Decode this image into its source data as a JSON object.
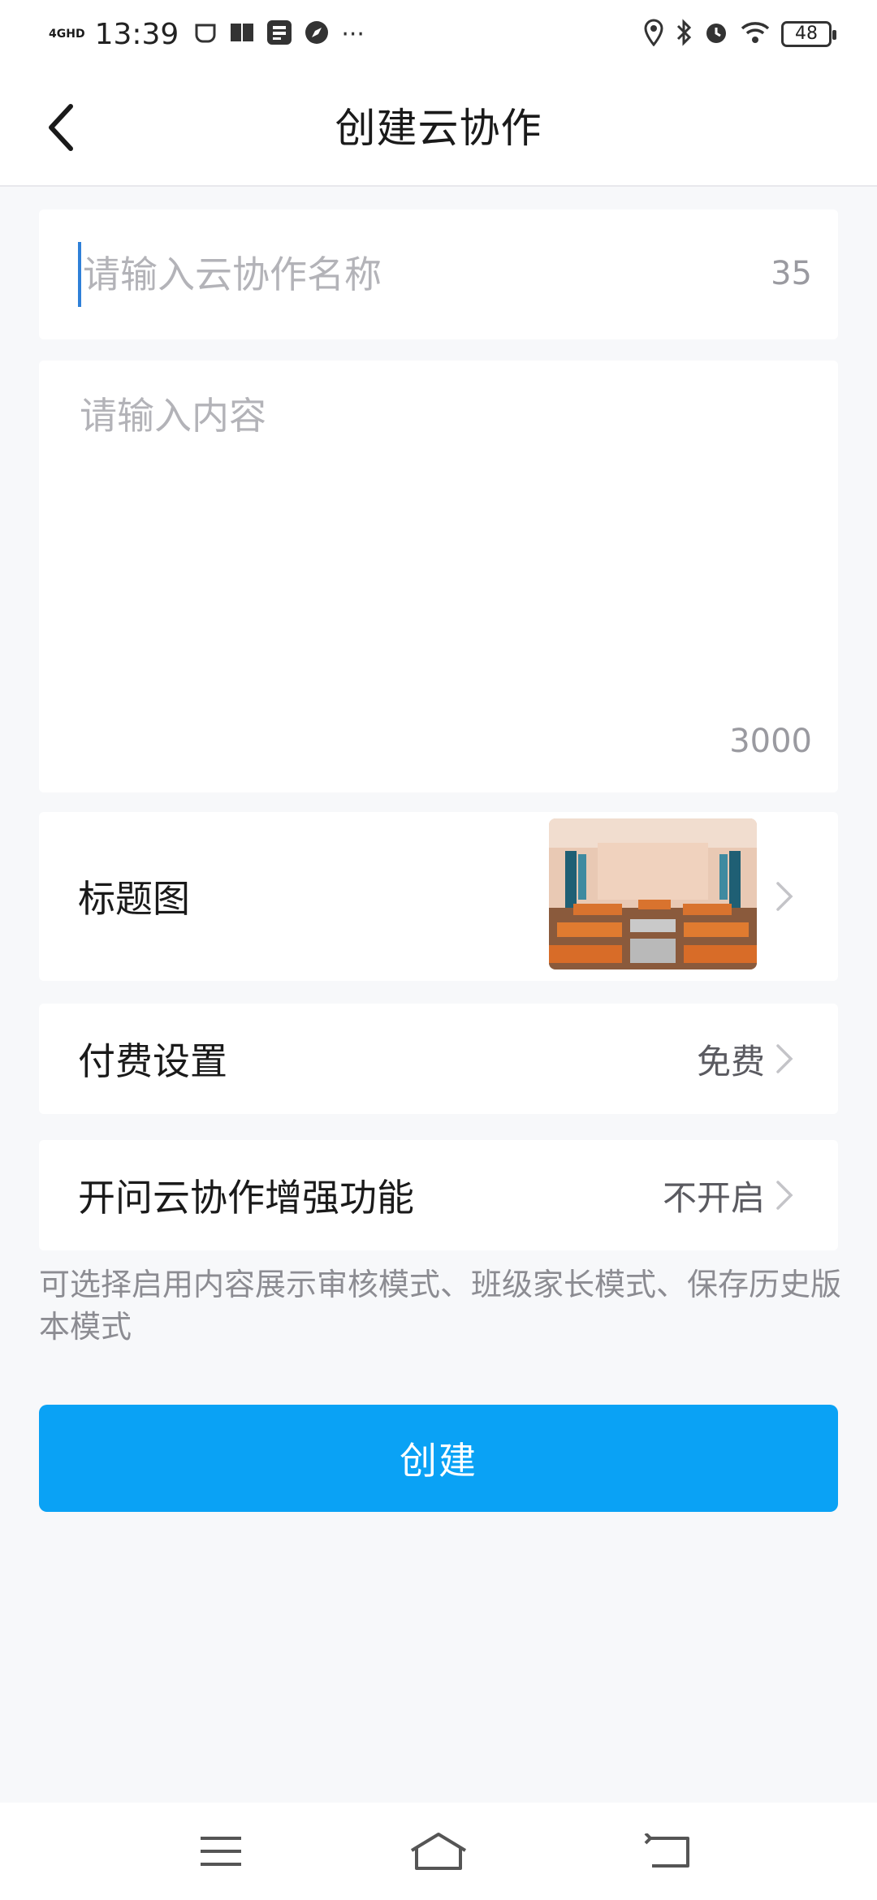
{
  "status_bar": {
    "network": "4GHD",
    "time": "13:39",
    "more": "···",
    "battery": "48"
  },
  "nav": {
    "title": "创建云协作"
  },
  "form": {
    "name_placeholder": "请输入云协作名称",
    "name_counter": "35",
    "content_placeholder": "请输入内容",
    "content_counter": "3000"
  },
  "rows": {
    "cover_label": "标题图",
    "pay_label": "付费设置",
    "pay_value": "免费",
    "enhance_label": "开问云协作增强功能",
    "enhance_value": "不开启"
  },
  "hint": "可选择启用内容展示审核模式、班级家长模式、保存历史版本模式",
  "create_button": "创建",
  "colors": {
    "accent": "#0aa2f5",
    "background": "#f7f8fa"
  }
}
